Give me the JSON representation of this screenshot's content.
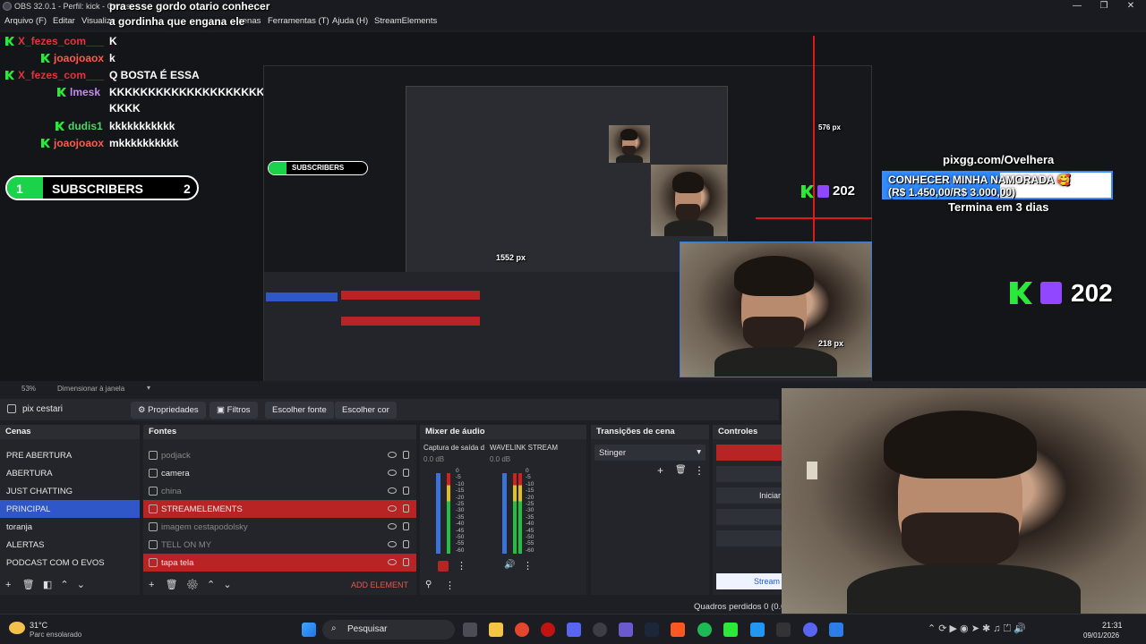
{
  "window": {
    "title": "OBS 32.0.1 - Perfil: kick - Cenas",
    "overlay_caption_line1": "pra esse gordo otario conhecer",
    "overlay_caption_line2": "a gordinha que engana ele"
  },
  "menu": [
    "Arquivo (F)",
    "Editar",
    "Visualiza",
    "cenas",
    "Ferramentas (T)",
    "Ajuda (H)",
    "StreamElements"
  ],
  "chat": [
    {
      "user": "X_fezes_com___",
      "msg": "K",
      "color": "#e0333c"
    },
    {
      "user": "joaojoaox",
      "msg": "k",
      "color": "#ff5a4a"
    },
    {
      "user": "X_fezes_com___",
      "msg": "Q BOSTA É ESSA",
      "color": "#e0333c"
    },
    {
      "user": "lmesk",
      "msg": "KKKKKKKKKKKKKKKKKKKKKKK",
      "msg2": "KKKK",
      "color": "#c48af5"
    },
    {
      "user": "dudis1",
      "msg": "kkkkkkkkkkk",
      "color": "#4fd46a"
    },
    {
      "user": "joaojoaox",
      "msg": "mkkkkkkkkkk",
      "color": "#ff5a4a"
    }
  ],
  "subs": {
    "left": "1",
    "label": "SUBSCRIBERS",
    "right": "2"
  },
  "goal": {
    "site": "pixgg.com/Ovelhera",
    "title": "CONHECER MINHA NAMORADA 🥰",
    "amount": "(R$ 1.450,00/R$ 3.000,00)",
    "ends": "Termina em 3 dias"
  },
  "viewers": "202",
  "measure": {
    "a": "1552 px",
    "b": "218 px",
    "c": "576 px"
  },
  "status_strip": {
    "zoom": "53%",
    "mode": "Dimensionar à janela"
  },
  "toolbar": {
    "scene": "pix cestari",
    "props": "Propriedades",
    "filters": "Filtros",
    "pick_font": "Escolher fonte",
    "pick_color": "Escolher cor"
  },
  "scenes": {
    "header": "Cenas",
    "items": [
      "PRE ABERTURA",
      "ABERTURA",
      "JUST CHATTING",
      "PRINCIPAL",
      "toranja",
      "ALERTAS",
      "PODCAST COM O EVOS"
    ],
    "selected": 3
  },
  "sources": {
    "header": "Fontes",
    "items": [
      {
        "label": "podjack",
        "state": "dim"
      },
      {
        "label": "camera",
        "state": "normal"
      },
      {
        "label": "china",
        "state": "dim"
      },
      {
        "label": "STREAMELEMENTS",
        "state": "red"
      },
      {
        "label": "imagem cestapodolsky",
        "state": "dim"
      },
      {
        "label": "TELL ON MY",
        "state": "dim"
      },
      {
        "label": "tapa tela",
        "state": "red"
      }
    ],
    "add": "ADD ELEMENT"
  },
  "mixer": {
    "header": "Mixer de áudio",
    "ch1": {
      "name": "Captura de saída d",
      "db": "0.0 dB"
    },
    "ch2": {
      "name": "WAVELINK STREAM",
      "db": "0.0 dB"
    },
    "ticks": [
      "0",
      "-5",
      "-10",
      "-15",
      "-20",
      "-25",
      "-30",
      "-35",
      "-40",
      "-45",
      "-50",
      "-55",
      "-60"
    ]
  },
  "transitions": {
    "header": "Transições de cena",
    "value": "Stinger"
  },
  "controls": {
    "header": "Controles",
    "start": "Iniciar",
    "stream": "Stream"
  },
  "status": {
    "dropped": "Quadros perdidos 0 (0.0"
  },
  "taskbar": {
    "temp": "31°C",
    "weather": "Parc ensolarado",
    "search": "Pesquisar",
    "time": "21:31",
    "date": "09/01/2026"
  }
}
